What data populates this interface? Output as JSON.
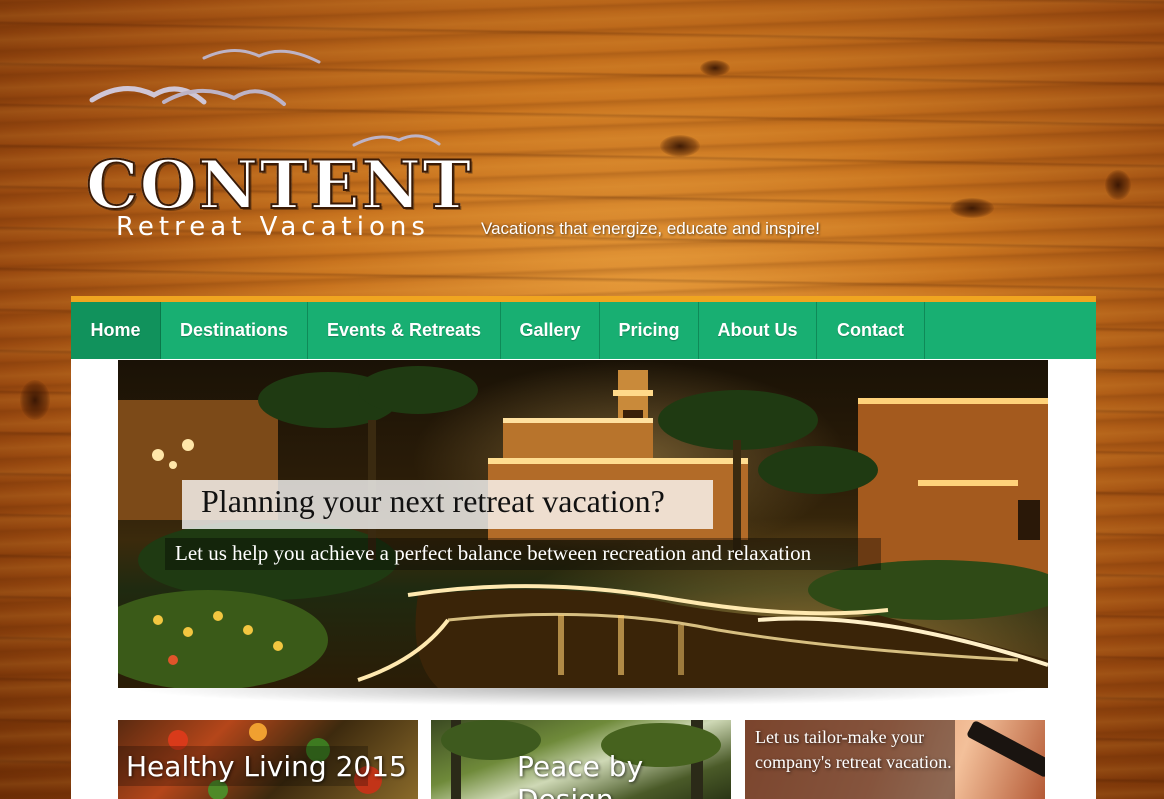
{
  "header": {
    "logo_title": "CONTENT",
    "logo_subtitle": "Retreat Vacations",
    "tagline": "Vacations that energize, educate and inspire!"
  },
  "nav": {
    "items": [
      {
        "label": "Home",
        "active": true
      },
      {
        "label": "Destinations",
        "active": false
      },
      {
        "label": "Events & Retreats",
        "active": false
      },
      {
        "label": "Gallery",
        "active": false
      },
      {
        "label": "Pricing",
        "active": false
      },
      {
        "label": "About Us",
        "active": false
      },
      {
        "label": "Contact",
        "active": false
      }
    ]
  },
  "hero": {
    "title": "Planning your next retreat vacation?",
    "subtitle": "Let us help you achieve a perfect balance between recreation and relaxation"
  },
  "cards": [
    {
      "label": "Healthy Living 2015"
    },
    {
      "label": "Peace by Design"
    },
    {
      "label": "Let us tailor-make your company's retreat vacation."
    }
  ],
  "colors": {
    "nav_green": "#18af72",
    "nav_active": "#11925c",
    "nav_accent": "#f0a520"
  }
}
